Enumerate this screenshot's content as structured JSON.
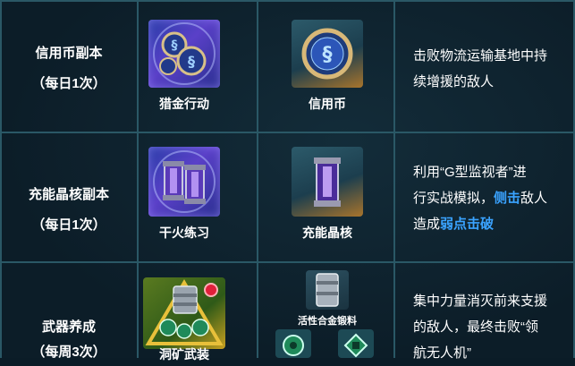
{
  "rows": [
    {
      "name": "信用币副本",
      "frequency": "（每日1次）",
      "items": [
        "猎金行动",
        "信用币"
      ],
      "desc_lines": [
        "击败物流运输基地中持",
        "续增援的敌人"
      ]
    },
    {
      "name": "充能晶核副本",
      "frequency": "（每日1次）",
      "items": [
        "干火练习",
        "充能晶核"
      ],
      "desc": {
        "line1": "利用“G型监视者”进",
        "line2_prefix": "行实战模拟，",
        "line2_highlight": "侧击",
        "line2_suffix": "敌人",
        "line3_prefix": "造成",
        "line3_highlight": "弱点击破"
      }
    },
    {
      "name": "武器养成",
      "frequency": "（每周3次）",
      "items": [
        "洞矿武装",
        "活性合金锻料"
      ],
      "desc_lines": [
        "集中力量消灭前来支援",
        "的敌人，最终击败“领",
        "航无人机”"
      ]
    }
  ],
  "icons": {
    "row1_item1": "credit-coins-icon",
    "row1_item2": "credit-coin-icon",
    "row2_item1": "energy-core-pair-icon",
    "row2_item2": "energy-core-icon",
    "row3_item1": "weapon-materials-icon",
    "row3_item2": "alloy-material-icon",
    "row3_item3": "green-gear-icon",
    "row3_item4": "green-chip-icon"
  },
  "colors": {
    "background": "#0c1d28",
    "grid_line": "#2a5866",
    "highlight": "#3aa3ff",
    "badge": "#e0203a"
  }
}
